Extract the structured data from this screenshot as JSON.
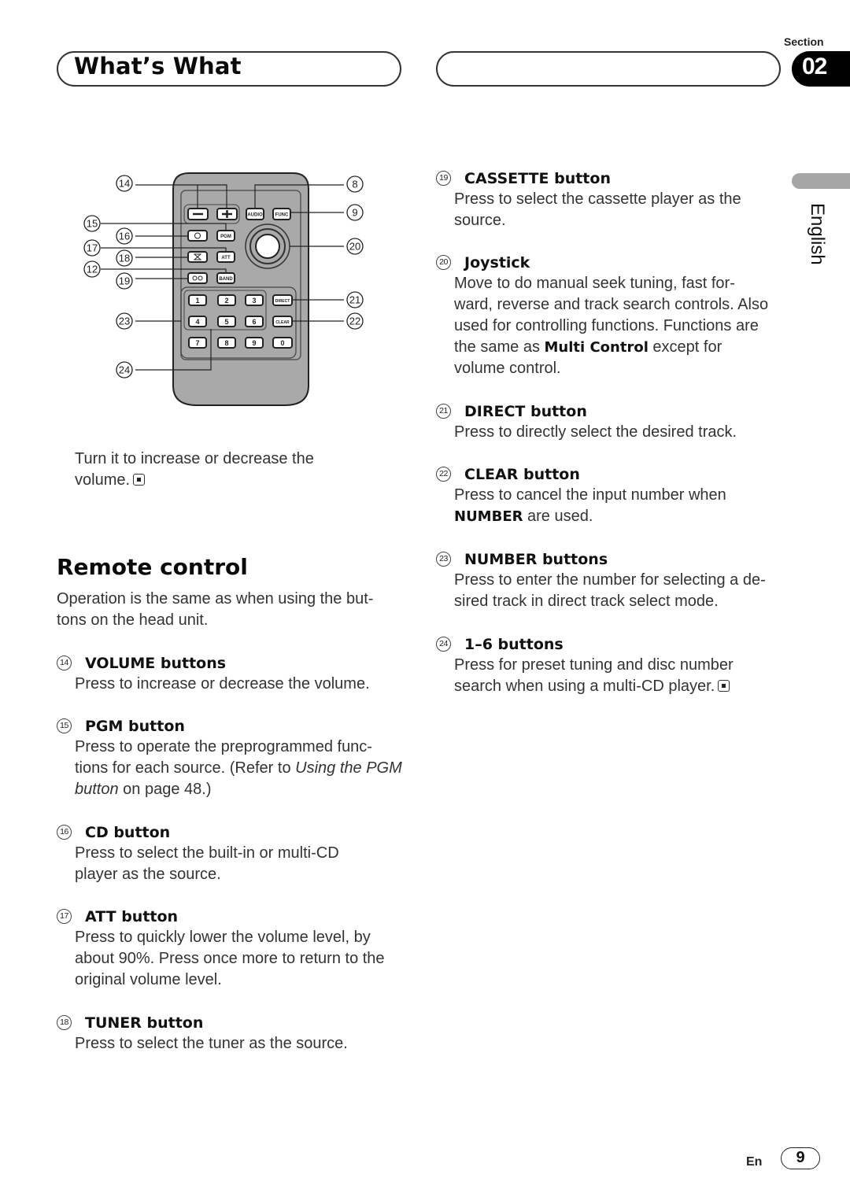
{
  "header": {
    "title": "What’s What",
    "section_label": "Section",
    "section_number": "02"
  },
  "language_tab": {
    "label": "English"
  },
  "remote_diagram": {
    "callouts": {
      "c14": "14",
      "c8": "8",
      "c9": "9",
      "c15": "15",
      "c16": "16",
      "c20": "20",
      "c17": "17",
      "c18": "18",
      "c12": "12",
      "c19": "19",
      "c21": "21",
      "c23": "23",
      "c22": "22",
      "c24": "24"
    },
    "buttons": {
      "minus": "−",
      "plus": "+",
      "audio": "AUDIO",
      "func": "FUNC",
      "pgm": "PGM",
      "att": "ATT",
      "band": "BAND",
      "direct": "DIRECT",
      "clear": "CLEAR",
      "n1": "1",
      "n2": "2",
      "n3": "3",
      "n4": "4",
      "n5": "5",
      "n6": "6",
      "n7": "7",
      "n8": "8",
      "n9": "9",
      "n0": "0"
    }
  },
  "continuation_text": "Turn it to increase or decrease the volume.",
  "remote_control": {
    "title": "Remote control",
    "intro": "Operation is the same as when using the but- tons on the head unit."
  },
  "left_entries": [
    {
      "num": "14",
      "title": "VOLUME buttons",
      "desc": "Press to increase or decrease the volume."
    },
    {
      "num": "15",
      "title": "PGM button",
      "desc_pre": "Press to operate the preprogrammed func- tions for each source. (Refer to ",
      "desc_italic": "Using the PGM button",
      "desc_post": " on page 48.)"
    },
    {
      "num": "16",
      "title": "CD button",
      "desc": "Press to select the built-in or multi-CD player as the source."
    },
    {
      "num": "17",
      "title": "ATT button",
      "desc": "Press to quickly lower the volume level, by about 90%. Press once more to return to the original volume level."
    },
    {
      "num": "18",
      "title": "TUNER button",
      "desc": "Press to select the tuner as the source."
    }
  ],
  "right_entries": [
    {
      "num": "19",
      "title": "CASSETTE button",
      "desc": "Press to select the cassette player as the source."
    },
    {
      "num": "20",
      "title": "Joystick",
      "desc_pre": "Move to do manual seek tuning, fast for- ward, reverse and track search controls. Also used for controlling functions. Functions are the same as ",
      "desc_bold": "Multi Control",
      "desc_post": " except for volume control."
    },
    {
      "num": "21",
      "title": "DIRECT button",
      "desc": "Press to directly select the desired track."
    },
    {
      "num": "22",
      "title": "CLEAR button",
      "desc_pre": "Press to cancel the input number when ",
      "desc_bold": "NUMBER",
      "desc_post": " are used."
    },
    {
      "num": "23",
      "title": "NUMBER buttons",
      "desc": "Press to enter the number for selecting a de- sired track in direct track select mode."
    },
    {
      "num": "24",
      "title": "1–6 buttons",
      "desc": "Press for preset tuning and disc number search when using a multi-CD player."
    }
  ],
  "footer": {
    "lang_code": "En",
    "page_number": "9"
  }
}
